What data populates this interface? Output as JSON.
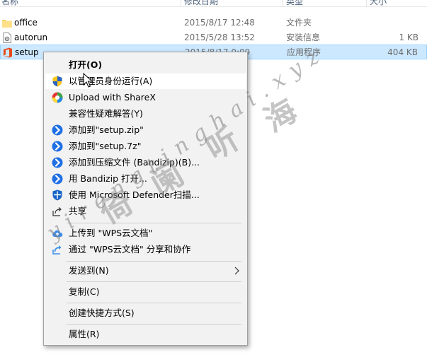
{
  "explorer": {
    "columns": [
      "名称",
      "修改日期",
      "类型",
      "大小"
    ],
    "rows": [
      {
        "name": "office",
        "date": "2015/8/17 12:48",
        "type": "文件夹",
        "size": "",
        "icon": "folder-icon",
        "selected": false
      },
      {
        "name": "autorun",
        "date": "2015/5/28 13:52",
        "type": "安装信息",
        "size": "1 KB",
        "icon": "setup-info-file-icon",
        "selected": false
      },
      {
        "name": "setup",
        "date": "2015/8/17 0:09",
        "type": "应用程序",
        "size": "404 KB",
        "icon": "office-app-icon",
        "selected": true
      }
    ]
  },
  "context_menu": {
    "open": "打开(O)",
    "run_as_admin": "以管理员身份运行(A)",
    "upload_sharex": "Upload with ShareX",
    "compat": "兼容性疑难解答(Y)",
    "add_zip": "添加到\"setup.zip\"",
    "add_7z": "添加到\"setup.7z\"",
    "add_archive": "添加到压缩文件 (Bandizip)(B)...",
    "open_bandizip": "用 Bandizip 打开...",
    "defender": "使用 Microsoft Defender扫描...",
    "share": "共享",
    "upload_wps": "上传到 \"WPS云文档\"",
    "share_wps": "通过 \"WPS云文档\" 分享和协作",
    "send_to": "发送到(N)",
    "copy": "复制(C)",
    "shortcut": "创建快捷方式(S)",
    "properties": "属性(R)"
  },
  "watermark": {
    "latin": "yirengtinghai.xyz",
    "chinese": [
      "倚",
      "阑",
      "听",
      "海"
    ]
  },
  "colors": {
    "selection": "#cce8ff",
    "menu_bg": "#f2f2f2",
    "bandizip_blue": "#1f6fe5",
    "wps_blue": "#3b8ded"
  }
}
